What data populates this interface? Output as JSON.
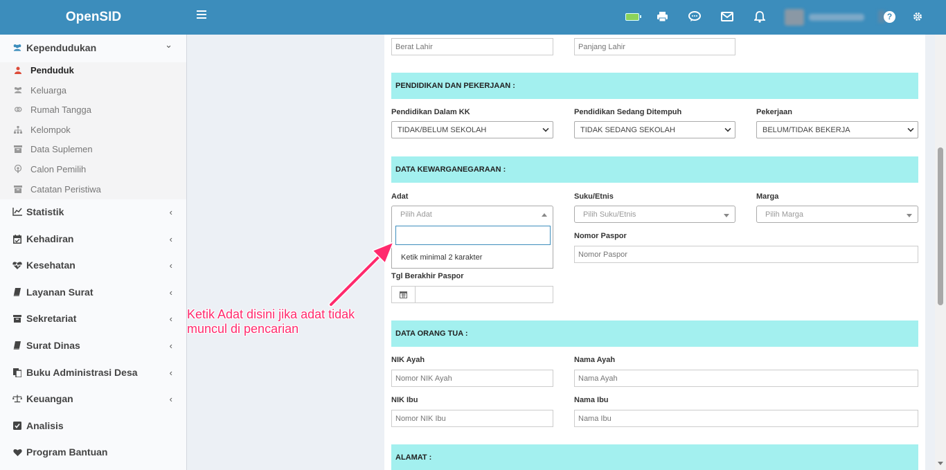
{
  "app": {
    "title": "OpenSID"
  },
  "colors": {
    "header": "#3c8dbc",
    "section_band": "#a3f0ef",
    "annotation": "#ff2a6d",
    "active_icon": "#dd4b39",
    "brand_icon": "#3c8dbc"
  },
  "header": {
    "icons": [
      "menu-icon",
      "battery-icon",
      "print-icon",
      "chat-icon",
      "mail-icon",
      "bell-icon",
      "avatar",
      "help-icon",
      "gear-icon"
    ],
    "help_label": "?"
  },
  "sidebar": {
    "main": {
      "label": "Kependudukan",
      "icon": "users-icon",
      "chevron": "⌄"
    },
    "sub_items": [
      {
        "label": "Penduduk",
        "icon": "user-icon",
        "active": true
      },
      {
        "label": "Keluarga",
        "icon": "users-icon"
      },
      {
        "label": "Rumah Tangga",
        "icon": "venus-mars-icon"
      },
      {
        "label": "Kelompok",
        "icon": "sitemap-icon"
      },
      {
        "label": "Data Suplemen",
        "icon": "archive-icon"
      },
      {
        "label": "Calon Pemilih",
        "icon": "podcast-icon"
      },
      {
        "label": "Catatan Peristiwa",
        "icon": "archive-icon"
      }
    ],
    "items": [
      {
        "label": "Statistik",
        "icon": "chart-icon",
        "chevron": "‹"
      },
      {
        "label": "Kehadiran",
        "icon": "calendar-check-icon",
        "chevron": "‹"
      },
      {
        "label": "Kesehatan",
        "icon": "heartbeat-icon",
        "chevron": "‹"
      },
      {
        "label": "Layanan Surat",
        "icon": "book-icon",
        "chevron": "‹"
      },
      {
        "label": "Sekretariat",
        "icon": "archive-icon",
        "chevron": "‹"
      },
      {
        "label": "Surat Dinas",
        "icon": "book-icon",
        "chevron": "‹"
      },
      {
        "label": "Buku Administrasi Desa",
        "icon": "copy-icon",
        "chevron": "‹"
      },
      {
        "label": "Keuangan",
        "icon": "balance-icon",
        "chevron": "‹"
      },
      {
        "label": "Analisis",
        "icon": "check-square-icon",
        "chevron": ""
      },
      {
        "label": "Program Bantuan",
        "icon": "heart-icon",
        "chevron": ""
      }
    ]
  },
  "form": {
    "berat_lahir": {
      "placeholder": "Berat Lahir"
    },
    "panjang_lahir": {
      "placeholder": "Panjang Lahir"
    },
    "sections": {
      "pendidikan": "PENDIDIKAN DAN PEKERJAAN :",
      "kewarganegaraan": "DATA KEWARGANEGARAAN :",
      "orang_tua": "DATA ORANG TUA :",
      "alamat": "ALAMAT :"
    },
    "pendidikan_kk": {
      "label": "Pendidikan Dalam KK",
      "value": "TIDAK/BELUM SEKOLAH"
    },
    "pendidikan_sedang": {
      "label": "Pendidikan Sedang Ditempuh",
      "value": "TIDAK SEDANG SEKOLAH"
    },
    "pekerjaan": {
      "label": "Pekerjaan",
      "value": "BELUM/TIDAK BEKERJA"
    },
    "adat": {
      "label": "Adat",
      "placeholder": "Pilih Adat",
      "dropdown_message": "Ketik minimal 2 karakter"
    },
    "suku": {
      "label": "Suku/Etnis",
      "placeholder": "Pilih Suku/Etnis"
    },
    "marga": {
      "label": "Marga",
      "placeholder": "Pilih Marga"
    },
    "nomor_paspor": {
      "label": "Nomor Paspor",
      "placeholder": "Nomor Paspor"
    },
    "tgl_paspor": {
      "label": "Tgl Berakhir Paspor",
      "value": ""
    },
    "nik_ayah": {
      "label": "NIK Ayah",
      "placeholder": "Nomor NIK Ayah"
    },
    "nama_ayah": {
      "label": "Nama Ayah",
      "placeholder": "Nama Ayah"
    },
    "nik_ibu": {
      "label": "NIK Ibu",
      "placeholder": "Nomor NIK Ibu"
    },
    "nama_ibu": {
      "label": "Nama Ibu",
      "placeholder": "Nama Ibu"
    }
  },
  "annotation": {
    "text": "Ketik Adat disini jika adat tidak muncul di pencarian"
  }
}
